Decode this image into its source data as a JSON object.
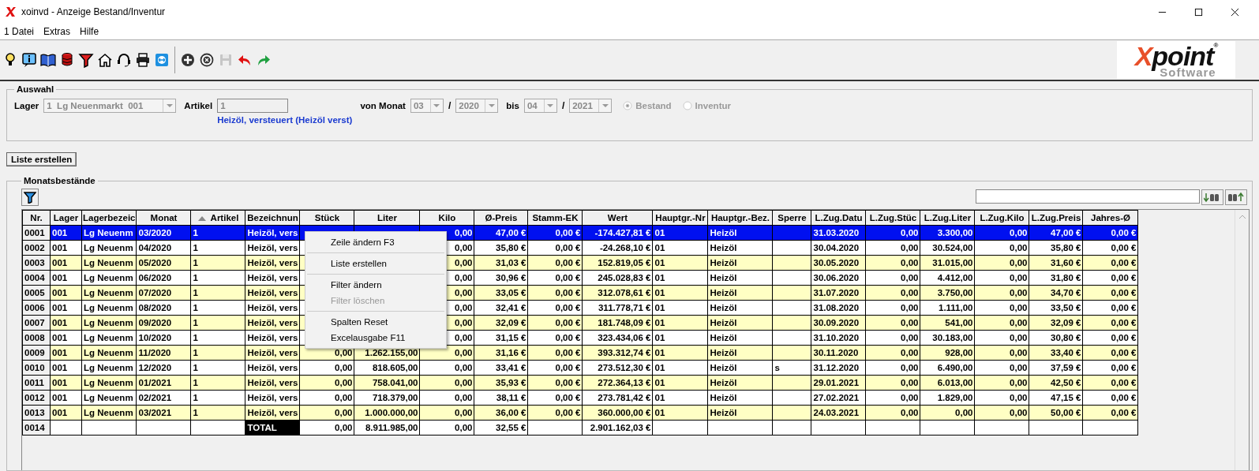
{
  "window": {
    "title": "xoinvd - Anzeige Bestand/Inventur"
  },
  "menu": [
    "1 Datei",
    "Extras",
    "Hilfe"
  ],
  "toolbar": [
    {
      "kind": "bulb",
      "disabled": false
    },
    {
      "kind": "info",
      "disabled": false
    },
    {
      "kind": "book",
      "disabled": false
    },
    {
      "kind": "stack",
      "disabled": false
    },
    {
      "kind": "filter",
      "disabled": false
    },
    {
      "kind": "home",
      "disabled": false
    },
    {
      "kind": "headset",
      "disabled": false
    },
    {
      "kind": "printer",
      "disabled": false
    },
    {
      "kind": "remote",
      "disabled": false
    },
    {
      "kind": "separator"
    },
    {
      "kind": "add",
      "disabled": false
    },
    {
      "kind": "cancel",
      "disabled": false
    },
    {
      "kind": "save",
      "disabled": true
    },
    {
      "kind": "undo",
      "disabled": false
    },
    {
      "kind": "redo",
      "disabled": false
    }
  ],
  "logo": {
    "initial": "X",
    "name": "point",
    "tagline": "Software",
    "mark": "®"
  },
  "selection": {
    "title": "Auswahl",
    "lager": {
      "label": "Lager",
      "value": "1  Lg Neuenmarkt  001",
      "disabled": true
    },
    "artikel": {
      "label": "Artikel",
      "value": "1",
      "disabled": true,
      "description": "Heizöl, versteuert (Heizöl verst)"
    },
    "from": {
      "label": "von Monat",
      "month": "03",
      "separator": "/",
      "year": "2020",
      "disabled": true
    },
    "to": {
      "label": "bis",
      "month": "04",
      "separator": "/",
      "year": "2021",
      "disabled": true
    },
    "modes": [
      {
        "label": "Bestand",
        "selected": true,
        "disabled": true
      },
      {
        "label": "Inventur",
        "selected": false,
        "disabled": true
      }
    ]
  },
  "create_button": "Liste erstellen",
  "table": {
    "title": "Monatsbestände",
    "columns": [
      {
        "label": "Nr.",
        "kind": "text",
        "sorted": false
      },
      {
        "label": "Lager",
        "kind": "text",
        "sorted": false
      },
      {
        "label": "Lagerbezeic",
        "kind": "text",
        "sorted": false
      },
      {
        "label": "Monat",
        "kind": "text",
        "sorted": false
      },
      {
        "label": "Artikel",
        "kind": "text",
        "sorted": true
      },
      {
        "label": "Bezeichnun",
        "kind": "text",
        "sorted": false
      },
      {
        "label": "Stück",
        "kind": "number",
        "sorted": false
      },
      {
        "label": "Liter",
        "kind": "number",
        "sorted": false
      },
      {
        "label": "Kilo",
        "kind": "number",
        "sorted": false
      },
      {
        "label": "Ø-Preis",
        "kind": "number",
        "sorted": false
      },
      {
        "label": "Stamm-EK",
        "kind": "number",
        "sorted": false
      },
      {
        "label": "Wert",
        "kind": "number",
        "sorted": false
      },
      {
        "label": "Hauptgr.-Nr",
        "kind": "text",
        "sorted": false
      },
      {
        "label": "Hauptgr.-Bez.",
        "kind": "text",
        "sorted": false
      },
      {
        "label": "Sperre",
        "kind": "text",
        "sorted": false
      },
      {
        "label": "L.Zug.Datu",
        "kind": "text",
        "sorted": false
      },
      {
        "label": "L.Zug.Stüc",
        "kind": "number",
        "sorted": false
      },
      {
        "label": "L.Zug.Liter",
        "kind": "number",
        "sorted": false
      },
      {
        "label": "L.Zug.Kilo",
        "kind": "number",
        "sorted": false
      },
      {
        "label": "L.Zug.Preis",
        "kind": "number",
        "sorted": false
      },
      {
        "label": "Jahres-Ø",
        "kind": "number",
        "sorted": false
      }
    ],
    "rows": [
      {
        "kind": "data",
        "selected": true,
        "cells": [
          "0001",
          "001",
          "Lg Neuenm",
          "03/2020",
          "1",
          "Heizöl, vers",
          null,
          null,
          "0,00",
          "47,00 €",
          "0,00 €",
          "-174.427,81 €",
          "01",
          "Heizöl",
          null,
          "31.03.2020",
          "0,00",
          "3.300,00",
          "0,00",
          "47,00 €",
          "0,00 €"
        ]
      },
      {
        "kind": "data",
        "selected": false,
        "cells": [
          "0002",
          "001",
          "Lg Neuenm",
          "04/2020",
          "1",
          "Heizöl, vers",
          null,
          null,
          "0,00",
          "35,80 €",
          "0,00 €",
          "-24.268,10 €",
          "01",
          "Heizöl",
          null,
          "30.04.2020",
          "0,00",
          "30.524,00",
          "0,00",
          "35,80 €",
          "0,00 €"
        ]
      },
      {
        "kind": "data",
        "selected": false,
        "cells": [
          "0003",
          "001",
          "Lg Neuenm",
          "05/2020",
          "1",
          "Heizöl, vers",
          null,
          null,
          "0,00",
          "31,03 €",
          "0,00 €",
          "152.819,05 €",
          "01",
          "Heizöl",
          null,
          "30.05.2020",
          "0,00",
          "31.015,00",
          "0,00",
          "31,60 €",
          "0,00 €"
        ]
      },
      {
        "kind": "data",
        "selected": false,
        "cells": [
          "0004",
          "001",
          "Lg Neuenm",
          "06/2020",
          "1",
          "Heizöl, vers",
          null,
          null,
          "0,00",
          "30,96 €",
          "0,00 €",
          "245.028,83 €",
          "01",
          "Heizöl",
          null,
          "30.06.2020",
          "0,00",
          "4.412,00",
          "0,00",
          "31,80 €",
          "0,00 €"
        ]
      },
      {
        "kind": "data",
        "selected": false,
        "cells": [
          "0005",
          "001",
          "Lg Neuenm",
          "07/2020",
          "1",
          "Heizöl, vers",
          null,
          null,
          "0,00",
          "33,05 €",
          "0,00 €",
          "312.078,61 €",
          "01",
          "Heizöl",
          null,
          "31.07.2020",
          "0,00",
          "3.750,00",
          "0,00",
          "34,70 €",
          "0,00 €"
        ]
      },
      {
        "kind": "data",
        "selected": false,
        "cells": [
          "0006",
          "001",
          "Lg Neuenm",
          "08/2020",
          "1",
          "Heizöl, vers",
          null,
          null,
          "0,00",
          "32,41 €",
          "0,00 €",
          "311.778,71 €",
          "01",
          "Heizöl",
          null,
          "31.08.2020",
          "0,00",
          "1.111,00",
          "0,00",
          "33,50 €",
          "0,00 €"
        ]
      },
      {
        "kind": "data",
        "selected": false,
        "cells": [
          "0007",
          "001",
          "Lg Neuenm",
          "09/2020",
          "1",
          "Heizöl, vers",
          null,
          null,
          "0,00",
          "32,09 €",
          "0,00 €",
          "181.748,09 €",
          "01",
          "Heizöl",
          null,
          "30.09.2020",
          "0,00",
          "541,00",
          "0,00",
          "32,09 €",
          "0,00 €"
        ]
      },
      {
        "kind": "data",
        "selected": false,
        "cells": [
          "0008",
          "001",
          "Lg Neuenm",
          "10/2020",
          "1",
          "Heizöl, vers",
          null,
          null,
          "0,00",
          "31,15 €",
          "0,00 €",
          "323.434,06 €",
          "01",
          "Heizöl",
          null,
          "31.10.2020",
          "0,00",
          "30.183,00",
          "0,00",
          "30,80 €",
          "0,00 €"
        ]
      },
      {
        "kind": "data",
        "selected": false,
        "cells": [
          "0009",
          "001",
          "Lg Neuenm",
          "11/2020",
          "1",
          "Heizöl, vers",
          "0,00",
          "1.262.155,00",
          "0,00",
          "31,16 €",
          "0,00 €",
          "393.312,74 €",
          "01",
          "Heizöl",
          null,
          "30.11.2020",
          "0,00",
          "928,00",
          "0,00",
          "33,40 €",
          "0,00 €"
        ]
      },
      {
        "kind": "data",
        "selected": false,
        "cells": [
          "0010",
          "001",
          "Lg Neuenm",
          "12/2020",
          "1",
          "Heizöl, vers",
          "0,00",
          "818.605,00",
          "0,00",
          "33,41 €",
          "0,00 €",
          "273.512,30 €",
          "01",
          "Heizöl",
          "s",
          "31.12.2020",
          "0,00",
          "6.490,00",
          "0,00",
          "37,59 €",
          "0,00 €"
        ]
      },
      {
        "kind": "data",
        "selected": false,
        "cells": [
          "0011",
          "001",
          "Lg Neuenm",
          "01/2021",
          "1",
          "Heizöl, vers",
          "0,00",
          "758.041,00",
          "0,00",
          "35,93 €",
          "0,00 €",
          "272.364,13 €",
          "01",
          "Heizöl",
          null,
          "29.01.2021",
          "0,00",
          "6.013,00",
          "0,00",
          "42,50 €",
          "0,00 €"
        ]
      },
      {
        "kind": "data",
        "selected": false,
        "cells": [
          "0012",
          "001",
          "Lg Neuenm",
          "02/2021",
          "1",
          "Heizöl, vers",
          "0,00",
          "718.379,00",
          "0,00",
          "38,11 €",
          "0,00 €",
          "273.781,42 €",
          "01",
          "Heizöl",
          null,
          "27.02.2021",
          "0,00",
          "1.829,00",
          "0,00",
          "47,15 €",
          "0,00 €"
        ]
      },
      {
        "kind": "data",
        "selected": false,
        "cells": [
          "0013",
          "001",
          "Lg Neuenm",
          "03/2021",
          "1",
          "Heizöl, vers",
          "0,00",
          "1.000.000,00",
          "0,00",
          "36,00 €",
          "0,00 €",
          "360.000,00 €",
          "01",
          "Heizöl",
          null,
          "24.03.2021",
          "0,00",
          "0,00",
          "0,00",
          "50,00 €",
          "0,00 €"
        ]
      },
      {
        "kind": "total",
        "selected": false,
        "cells": [
          "0014",
          null,
          null,
          null,
          null,
          "TOTAL",
          "0,00",
          "8.911.985,00",
          "0,00",
          "32,55 €",
          null,
          "2.901.162,03 €",
          null,
          null,
          null,
          null,
          null,
          null,
          null,
          null,
          null
        ]
      }
    ]
  },
  "context_menu": [
    {
      "kind": "item",
      "label": "Zeile ändern F3",
      "disabled": false
    },
    {
      "kind": "separator"
    },
    {
      "kind": "item",
      "label": "Liste erstellen",
      "disabled": false
    },
    {
      "kind": "separator"
    },
    {
      "kind": "item",
      "label": "Filter ändern",
      "disabled": false
    },
    {
      "kind": "item",
      "label": "Filter löschen",
      "disabled": true
    },
    {
      "kind": "separator"
    },
    {
      "kind": "item",
      "label": "Spalten Reset",
      "disabled": false
    },
    {
      "kind": "item",
      "label": "Excelausgabe F11",
      "disabled": false
    }
  ]
}
